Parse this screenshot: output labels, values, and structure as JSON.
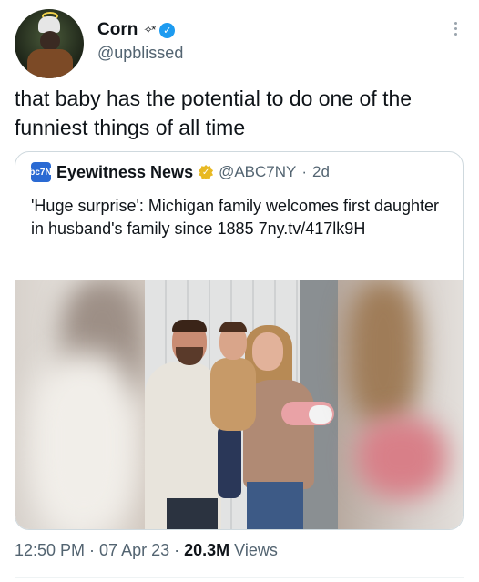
{
  "author": {
    "display_name": "Corn",
    "name_decoration": "✧*",
    "handle": "@upblissed",
    "verified": true,
    "verified_icon": "verified-check-icon",
    "verified_color": "#1d9bf0"
  },
  "tweet": {
    "text": "that baby has the potential to do one of the funniest things of all time"
  },
  "quoted_tweet": {
    "source_logo_text": "abc7NY",
    "display_name": "Eyewitness News",
    "badge_icon": "gold-verified-badge-icon",
    "badge_color": "#e8b923",
    "handle": "@ABC7NY",
    "separator": "·",
    "age": "2d",
    "text": "'Huge surprise': Michigan family welcomes first daughter in husband's family since 1885 7ny.tv/417lk9H",
    "media": {
      "kind": "photo",
      "icon": "family-photo"
    }
  },
  "meta": {
    "time": "12:50 PM",
    "separator1": " · ",
    "date": "07 Apr 23",
    "separator2": " · ",
    "views_count": "20.3M",
    "views_label": " Views"
  },
  "more_icon": "more-vertical-icon",
  "colors": {
    "text_primary": "#0f1419",
    "text_secondary": "#536471",
    "border": "#cfd9de"
  }
}
